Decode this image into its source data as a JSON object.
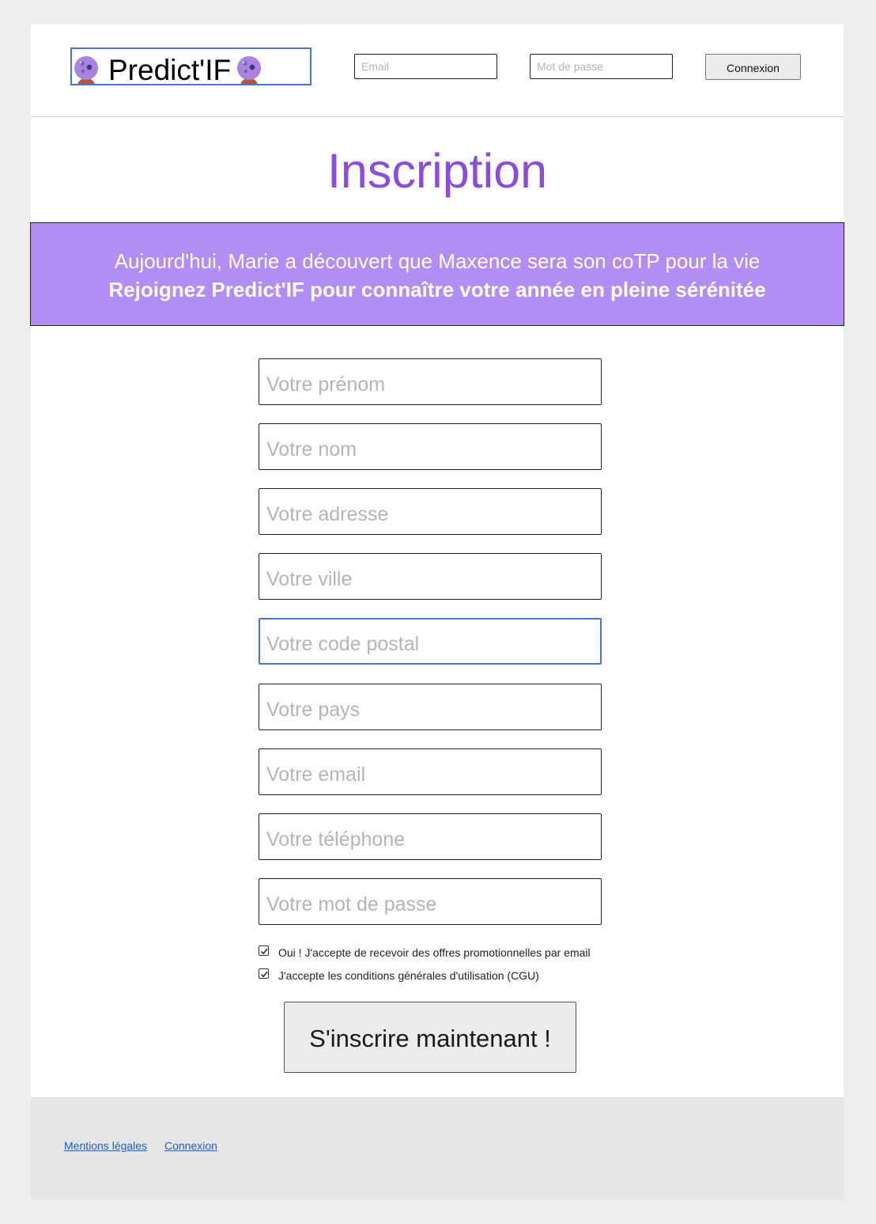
{
  "header": {
    "logo_text": "Predict'IF",
    "email_placeholder": "Email",
    "password_placeholder": "Mot de passe",
    "login_button": "Connexion"
  },
  "title": "Inscription",
  "banner": {
    "line1": "Aujourd'hui, Marie a découvert que Maxence sera son coTP pour la vie",
    "line2": "Rejoignez Predict'IF pour connaître votre année en pleine sérénitée"
  },
  "form": {
    "first_name_placeholder": "Votre prénom",
    "last_name_placeholder": "Votre nom",
    "address_placeholder": "Votre adresse",
    "city_placeholder": "Votre ville",
    "postal_code_placeholder": "Votre code postal",
    "country_placeholder": "Votre pays",
    "email_placeholder": "Votre email",
    "phone_placeholder": "Votre téléphone",
    "password_placeholder": "Votre mot de passe",
    "promo_checkbox_label": "Oui ! J'accepte de recevoir des offres promotionnelles par email",
    "promo_checked": true,
    "cgu_checkbox_label": "J'accepte les conditions générales d'utilisation (CGU)",
    "cgu_checked": true,
    "submit_label": "S'inscrire maintenant !"
  },
  "footer": {
    "legal_link": "Mentions légales",
    "login_link": "Connexion"
  },
  "colors": {
    "title": "#8a4ce0",
    "banner_bg": "#b28df5",
    "focus_border": "#4a78d0",
    "link": "#1a5fc7"
  },
  "icons": {
    "logo_left": "crystal-ball-icon",
    "logo_right": "crystal-ball-icon",
    "checkbox": "checkmark-icon"
  }
}
